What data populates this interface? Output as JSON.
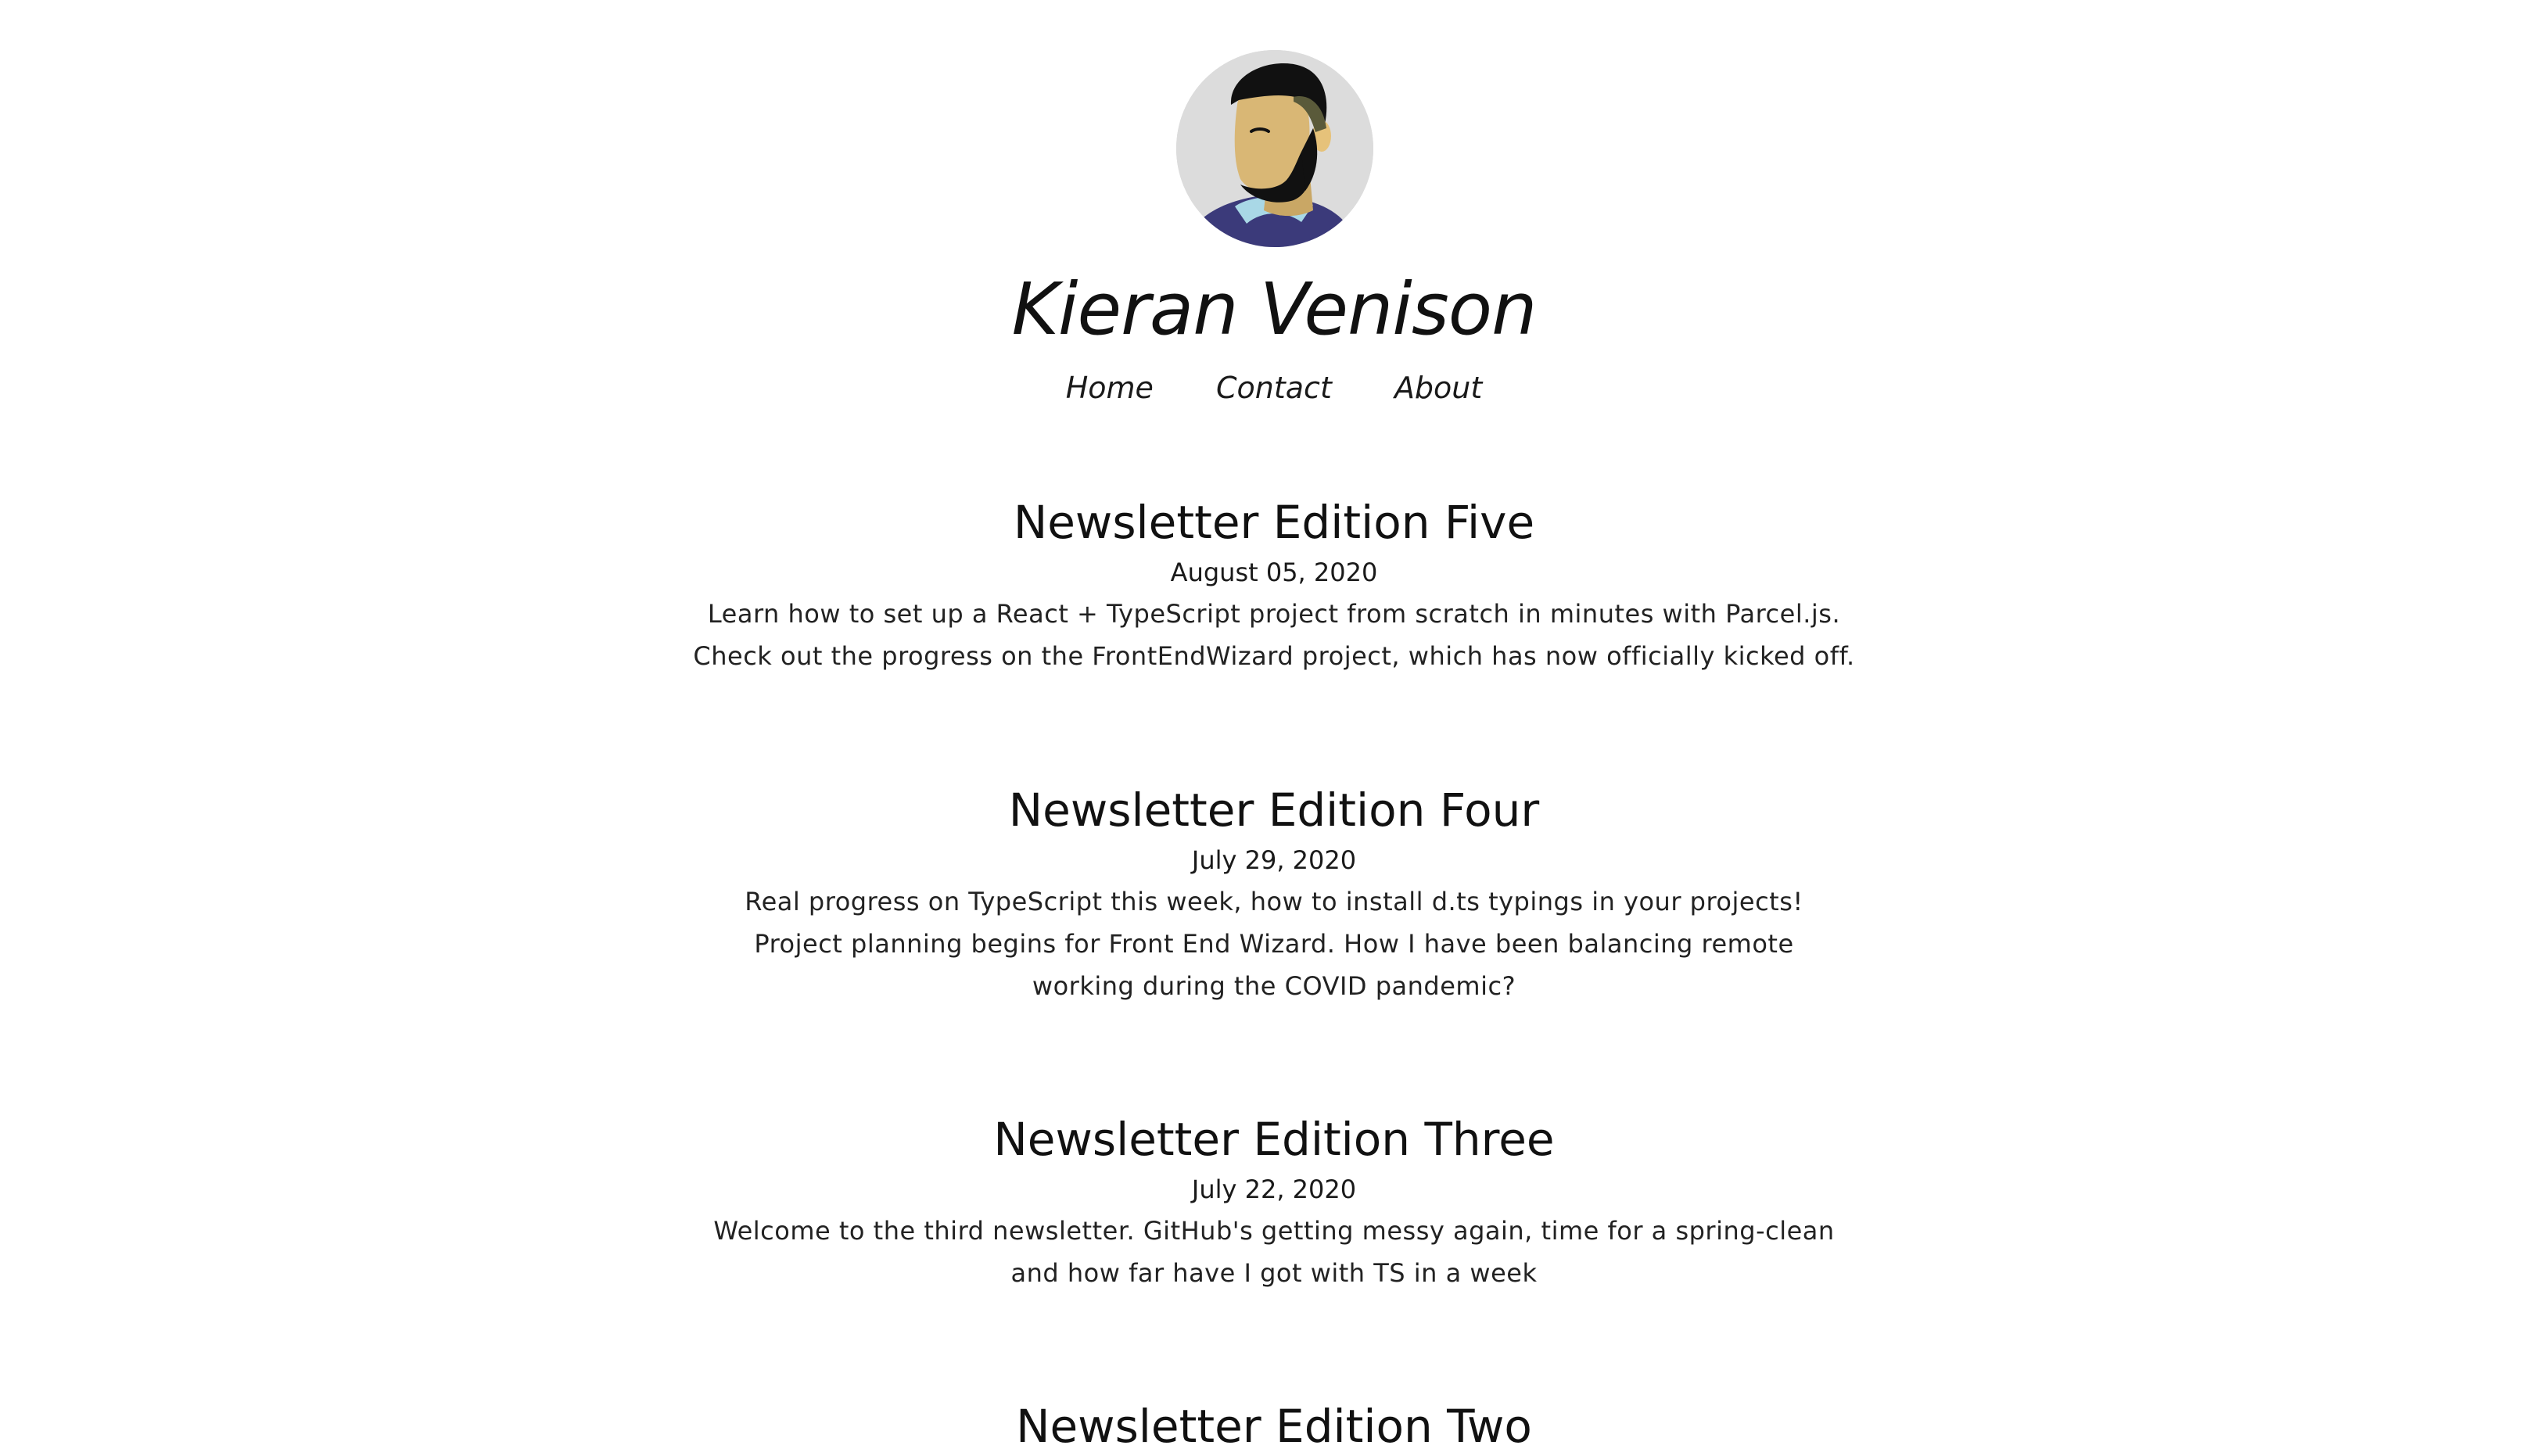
{
  "site": {
    "title": "Kieran Venison"
  },
  "nav": {
    "items": [
      {
        "label": "Home"
      },
      {
        "label": "Contact"
      },
      {
        "label": "About"
      }
    ]
  },
  "avatar": {
    "icon": "bearded-man-avatar",
    "colors": {
      "background": "#dcdcdc",
      "skin": "#d9b775",
      "hair": "#111111",
      "jacket": "#3b3a7a",
      "collar": "#a9d8e6"
    }
  },
  "posts": [
    {
      "title": "Newsletter Edition Five",
      "date": "August 05, 2020",
      "excerpt": "Learn how to set up a React + TypeScript project from scratch in minutes with Parcel.js. Check out the progress on the FrontEndWizard project, which has now officially kicked off."
    },
    {
      "title": "Newsletter Edition Four",
      "date": "July 29, 2020",
      "excerpt": "Real progress on TypeScript this week, how to install d.ts typings in your projects! Project planning begins for Front End Wizard. How I have been balancing remote working during the COVID pandemic?"
    },
    {
      "title": "Newsletter Edition Three",
      "date": "July 22, 2020",
      "excerpt": "Welcome to the third newsletter. GitHub's getting messy again, time for a spring-clean and how far have I got with TS in a week"
    },
    {
      "title": "Newsletter Edition Two"
    }
  ]
}
